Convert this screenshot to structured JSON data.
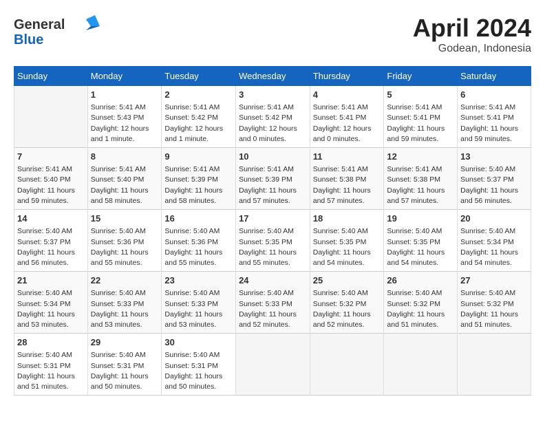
{
  "header": {
    "logo_line1": "General",
    "logo_line2": "Blue",
    "title": "April 2024",
    "location": "Godean, Indonesia"
  },
  "columns": [
    "Sunday",
    "Monday",
    "Tuesday",
    "Wednesday",
    "Thursday",
    "Friday",
    "Saturday"
  ],
  "weeks": [
    [
      {
        "day": "",
        "info": ""
      },
      {
        "day": "1",
        "info": "Sunrise: 5:41 AM\nSunset: 5:43 PM\nDaylight: 12 hours\nand 1 minute."
      },
      {
        "day": "2",
        "info": "Sunrise: 5:41 AM\nSunset: 5:42 PM\nDaylight: 12 hours\nand 1 minute."
      },
      {
        "day": "3",
        "info": "Sunrise: 5:41 AM\nSunset: 5:42 PM\nDaylight: 12 hours\nand 0 minutes."
      },
      {
        "day": "4",
        "info": "Sunrise: 5:41 AM\nSunset: 5:41 PM\nDaylight: 12 hours\nand 0 minutes."
      },
      {
        "day": "5",
        "info": "Sunrise: 5:41 AM\nSunset: 5:41 PM\nDaylight: 11 hours\nand 59 minutes."
      },
      {
        "day": "6",
        "info": "Sunrise: 5:41 AM\nSunset: 5:41 PM\nDaylight: 11 hours\nand 59 minutes."
      }
    ],
    [
      {
        "day": "7",
        "info": "Sunrise: 5:41 AM\nSunset: 5:40 PM\nDaylight: 11 hours\nand 59 minutes."
      },
      {
        "day": "8",
        "info": "Sunrise: 5:41 AM\nSunset: 5:40 PM\nDaylight: 11 hours\nand 58 minutes."
      },
      {
        "day": "9",
        "info": "Sunrise: 5:41 AM\nSunset: 5:39 PM\nDaylight: 11 hours\nand 58 minutes."
      },
      {
        "day": "10",
        "info": "Sunrise: 5:41 AM\nSunset: 5:39 PM\nDaylight: 11 hours\nand 57 minutes."
      },
      {
        "day": "11",
        "info": "Sunrise: 5:41 AM\nSunset: 5:38 PM\nDaylight: 11 hours\nand 57 minutes."
      },
      {
        "day": "12",
        "info": "Sunrise: 5:41 AM\nSunset: 5:38 PM\nDaylight: 11 hours\nand 57 minutes."
      },
      {
        "day": "13",
        "info": "Sunrise: 5:40 AM\nSunset: 5:37 PM\nDaylight: 11 hours\nand 56 minutes."
      }
    ],
    [
      {
        "day": "14",
        "info": "Sunrise: 5:40 AM\nSunset: 5:37 PM\nDaylight: 11 hours\nand 56 minutes."
      },
      {
        "day": "15",
        "info": "Sunrise: 5:40 AM\nSunset: 5:36 PM\nDaylight: 11 hours\nand 55 minutes."
      },
      {
        "day": "16",
        "info": "Sunrise: 5:40 AM\nSunset: 5:36 PM\nDaylight: 11 hours\nand 55 minutes."
      },
      {
        "day": "17",
        "info": "Sunrise: 5:40 AM\nSunset: 5:35 PM\nDaylight: 11 hours\nand 55 minutes."
      },
      {
        "day": "18",
        "info": "Sunrise: 5:40 AM\nSunset: 5:35 PM\nDaylight: 11 hours\nand 54 minutes."
      },
      {
        "day": "19",
        "info": "Sunrise: 5:40 AM\nSunset: 5:35 PM\nDaylight: 11 hours\nand 54 minutes."
      },
      {
        "day": "20",
        "info": "Sunrise: 5:40 AM\nSunset: 5:34 PM\nDaylight: 11 hours\nand 54 minutes."
      }
    ],
    [
      {
        "day": "21",
        "info": "Sunrise: 5:40 AM\nSunset: 5:34 PM\nDaylight: 11 hours\nand 53 minutes."
      },
      {
        "day": "22",
        "info": "Sunrise: 5:40 AM\nSunset: 5:33 PM\nDaylight: 11 hours\nand 53 minutes."
      },
      {
        "day": "23",
        "info": "Sunrise: 5:40 AM\nSunset: 5:33 PM\nDaylight: 11 hours\nand 53 minutes."
      },
      {
        "day": "24",
        "info": "Sunrise: 5:40 AM\nSunset: 5:33 PM\nDaylight: 11 hours\nand 52 minutes."
      },
      {
        "day": "25",
        "info": "Sunrise: 5:40 AM\nSunset: 5:32 PM\nDaylight: 11 hours\nand 52 minutes."
      },
      {
        "day": "26",
        "info": "Sunrise: 5:40 AM\nSunset: 5:32 PM\nDaylight: 11 hours\nand 51 minutes."
      },
      {
        "day": "27",
        "info": "Sunrise: 5:40 AM\nSunset: 5:32 PM\nDaylight: 11 hours\nand 51 minutes."
      }
    ],
    [
      {
        "day": "28",
        "info": "Sunrise: 5:40 AM\nSunset: 5:31 PM\nDaylight: 11 hours\nand 51 minutes."
      },
      {
        "day": "29",
        "info": "Sunrise: 5:40 AM\nSunset: 5:31 PM\nDaylight: 11 hours\nand 50 minutes."
      },
      {
        "day": "30",
        "info": "Sunrise: 5:40 AM\nSunset: 5:31 PM\nDaylight: 11 hours\nand 50 minutes."
      },
      {
        "day": "",
        "info": ""
      },
      {
        "day": "",
        "info": ""
      },
      {
        "day": "",
        "info": ""
      },
      {
        "day": "",
        "info": ""
      }
    ]
  ]
}
